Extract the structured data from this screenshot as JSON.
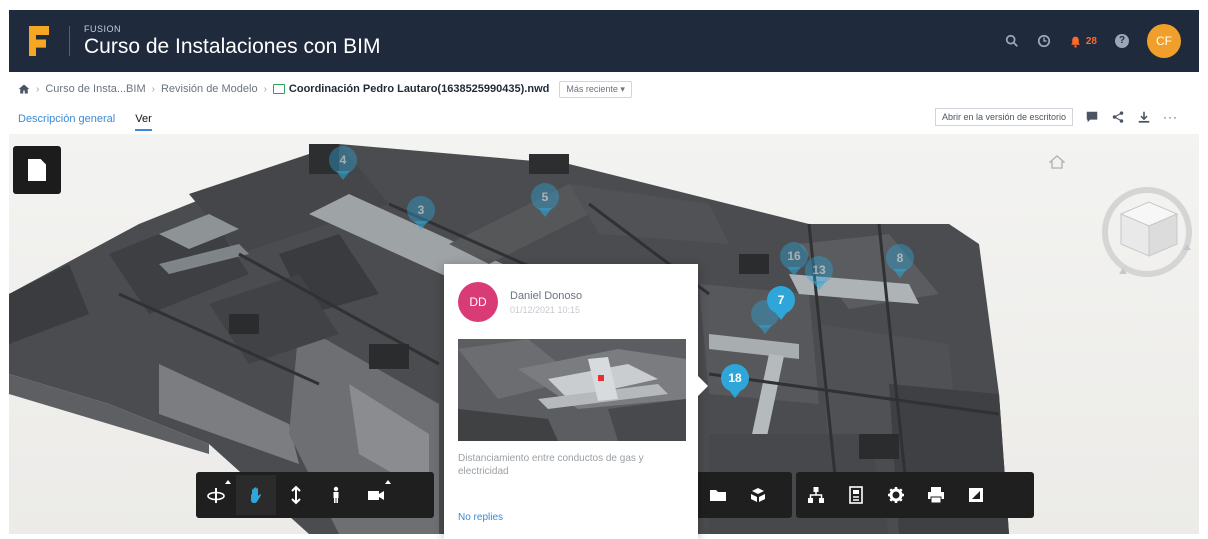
{
  "header": {
    "product": "FUSION",
    "project_title": "Curso de Instalaciones con BIM",
    "notification_count": "28",
    "avatar_initials": "CF"
  },
  "breadcrumb": {
    "items": [
      "Curso de Insta...BIM",
      "Revisión de Modelo"
    ],
    "file_name": "Coordinación Pedro Lautaro(1638525990435).nwd",
    "version_select": "Más reciente"
  },
  "tabs": [
    {
      "label": "Descripción general",
      "active": false
    },
    {
      "label": "Ver",
      "active": true
    }
  ],
  "actions": {
    "open_desktop_label": "Abrir en la versión de escritorio",
    "more_label": "···"
  },
  "pins": [
    "4",
    "3",
    "5",
    "16",
    "13",
    "8",
    "7",
    "18"
  ],
  "comment": {
    "initials": "DD",
    "author": "Daniel Donoso",
    "date": "01/12/2021 10:15",
    "description": "Distanciamiento entre conductos de gas y electricidad",
    "replies_label": "No replies"
  },
  "toolbar_icons": [
    "orbit-icon",
    "pan-icon",
    "dolly-icon",
    "first-person-icon",
    "camera-icon",
    "folder-icon",
    "explode-icon",
    "model-browser-icon",
    "properties-icon",
    "settings-icon",
    "print-icon",
    "fullscreen-icon"
  ],
  "colors": {
    "header_bg": "#1f2a3c",
    "accent_blue": "#2ea6d9",
    "avatar_orange": "#f0a02a",
    "comment_avatar": "#d83b75",
    "notification": "#ff6a2a"
  }
}
